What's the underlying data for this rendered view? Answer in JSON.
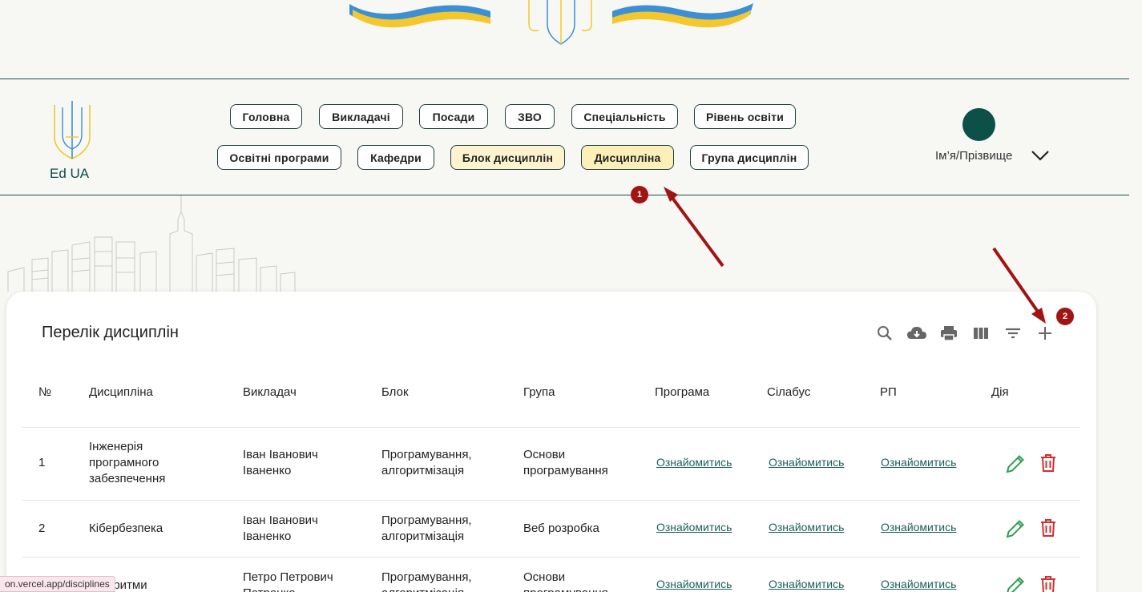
{
  "app": {
    "logo_text": "Ed UA"
  },
  "nav": {
    "row1": [
      "Головна",
      "Викладачі",
      "Посади",
      "ЗВО",
      "Спеціальність",
      "Рівень освіти"
    ],
    "row2": [
      "Освітні програми",
      "Кафедри",
      "Блок дисциплін",
      "Дисципліна",
      "Група дисциплін"
    ],
    "active": "Дисципліна"
  },
  "user": {
    "name": "Ім’я/Прізвище"
  },
  "annotations": {
    "badge1": "1",
    "badge2": "2"
  },
  "card": {
    "title": "Перелік дисциплін",
    "toolbar": [
      "search-icon",
      "cloud-download-icon",
      "print-icon",
      "columns-icon",
      "filter-icon",
      "add-icon"
    ]
  },
  "table": {
    "headers": [
      "№",
      "Дисципліна",
      "Викладач",
      "Блок",
      "Група",
      "Програма",
      "Сілабус",
      "РП",
      "Дія"
    ],
    "rows": [
      {
        "num": "1",
        "discipline": [
          "Інженерія",
          "програмного",
          "забезпечення"
        ],
        "teacher": [
          "Іван Іванович",
          "Іваненко"
        ],
        "block": [
          "Програмування,",
          "алгоритмізація"
        ],
        "group": [
          "Основи",
          "програмування"
        ],
        "program": "Ознайомитись",
        "syllabus": "Ознайомитись",
        "rp": "Ознайомитись"
      },
      {
        "num": "2",
        "discipline": [
          "Кібербезпека"
        ],
        "teacher": [
          "Іван Іванович",
          "Іваненко"
        ],
        "block": [
          "Програмування,",
          "алгоритмізація"
        ],
        "group": [
          "Веб розробка"
        ],
        "program": "Ознайомитись",
        "syllabus": "Ознайомитись",
        "rp": "Ознайомитись"
      },
      {
        "num": "",
        "discipline": [
          "оритми"
        ],
        "teacher": [
          "Петро Петрович",
          "Петренко"
        ],
        "block": [
          "Програмування,",
          "алгоритмізація"
        ],
        "group": [
          "Основи",
          "програмування"
        ],
        "program": "Ознайомитись",
        "syllabus": "Ознайомитись",
        "rp": "Ознайомитись"
      }
    ]
  },
  "status_url": "on.vercel.app/disciplines",
  "colors": {
    "accent": "#0c5048",
    "active_nav": "#fdf4cf",
    "link": "#1b5f58",
    "edit": "#2e9e4f",
    "delete": "#d32f2f",
    "annotation": "#a01414"
  }
}
